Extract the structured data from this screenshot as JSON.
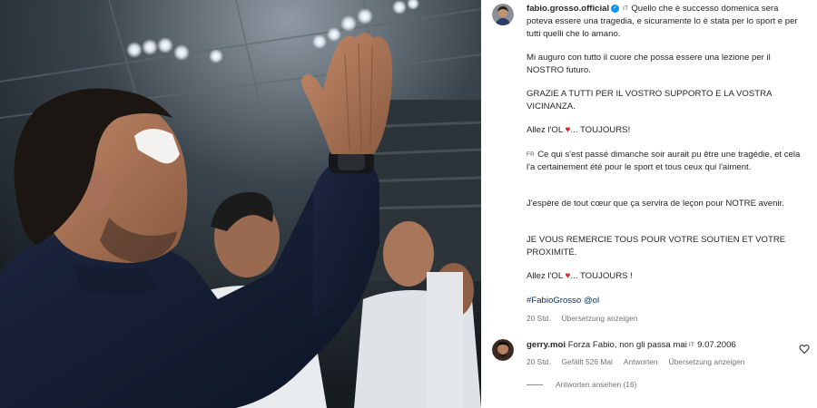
{
  "post": {
    "author": "fabio.grosso.official",
    "lang_it": "IT",
    "lang_fr": "FR",
    "p1": "Quello che è successo domenica sera poteva essere una tragedia, e sicuramente lo è stata per lo sport e per tutti quelli che lo amano.",
    "p2": "Mi auguro con tutto il cuore che possa essere una lezione per il NOSTRO futuro.",
    "p3": "GRAZIE A TUTTI PER IL VOSTRO SUPPORTO E LA VOSTRA VICINANZA.",
    "p4a": "Allez l'OL",
    "p4b": "... TOUJOURS!",
    "p5": "Ce qui s'est passé dimanche soir aurait pu être une tragédie, et cela l'a certainement été pour le sport et tous ceux qui l'aiment.",
    "p6": "J'espère de tout cœur que ça servira de leçon pour NOTRE avenir.",
    "p7": "JE VOUS REMERCIE TOUS POUR VOTRE SOUTIEN ET VOTRE PROXIMITÉ.",
    "p8a": "Allez l'OL",
    "p8b": "... TOUJOURS !",
    "hashtag": "#FabioGrosso",
    "mention": "@ol",
    "time": "20 Std.",
    "translate": "Übersetzung anzeigen"
  },
  "comment": {
    "user": "gerry.moi",
    "text": "Forza Fabio, non gli passa mai",
    "lang": "IT",
    "text2": "9.07.2006",
    "time": "20 Std.",
    "likes": "Gefällt 526 Mal",
    "reply": "Antworten",
    "translate": "Übersetzung anzeigen",
    "view_replies": "Antworten ansehen (16)"
  },
  "icons": {
    "verified": "verified-badge-icon",
    "heart": "heart-icon"
  },
  "colors": {
    "heart": "#e0202b",
    "link": "#00376b",
    "muted": "#737373",
    "verified": "#0095f6"
  }
}
